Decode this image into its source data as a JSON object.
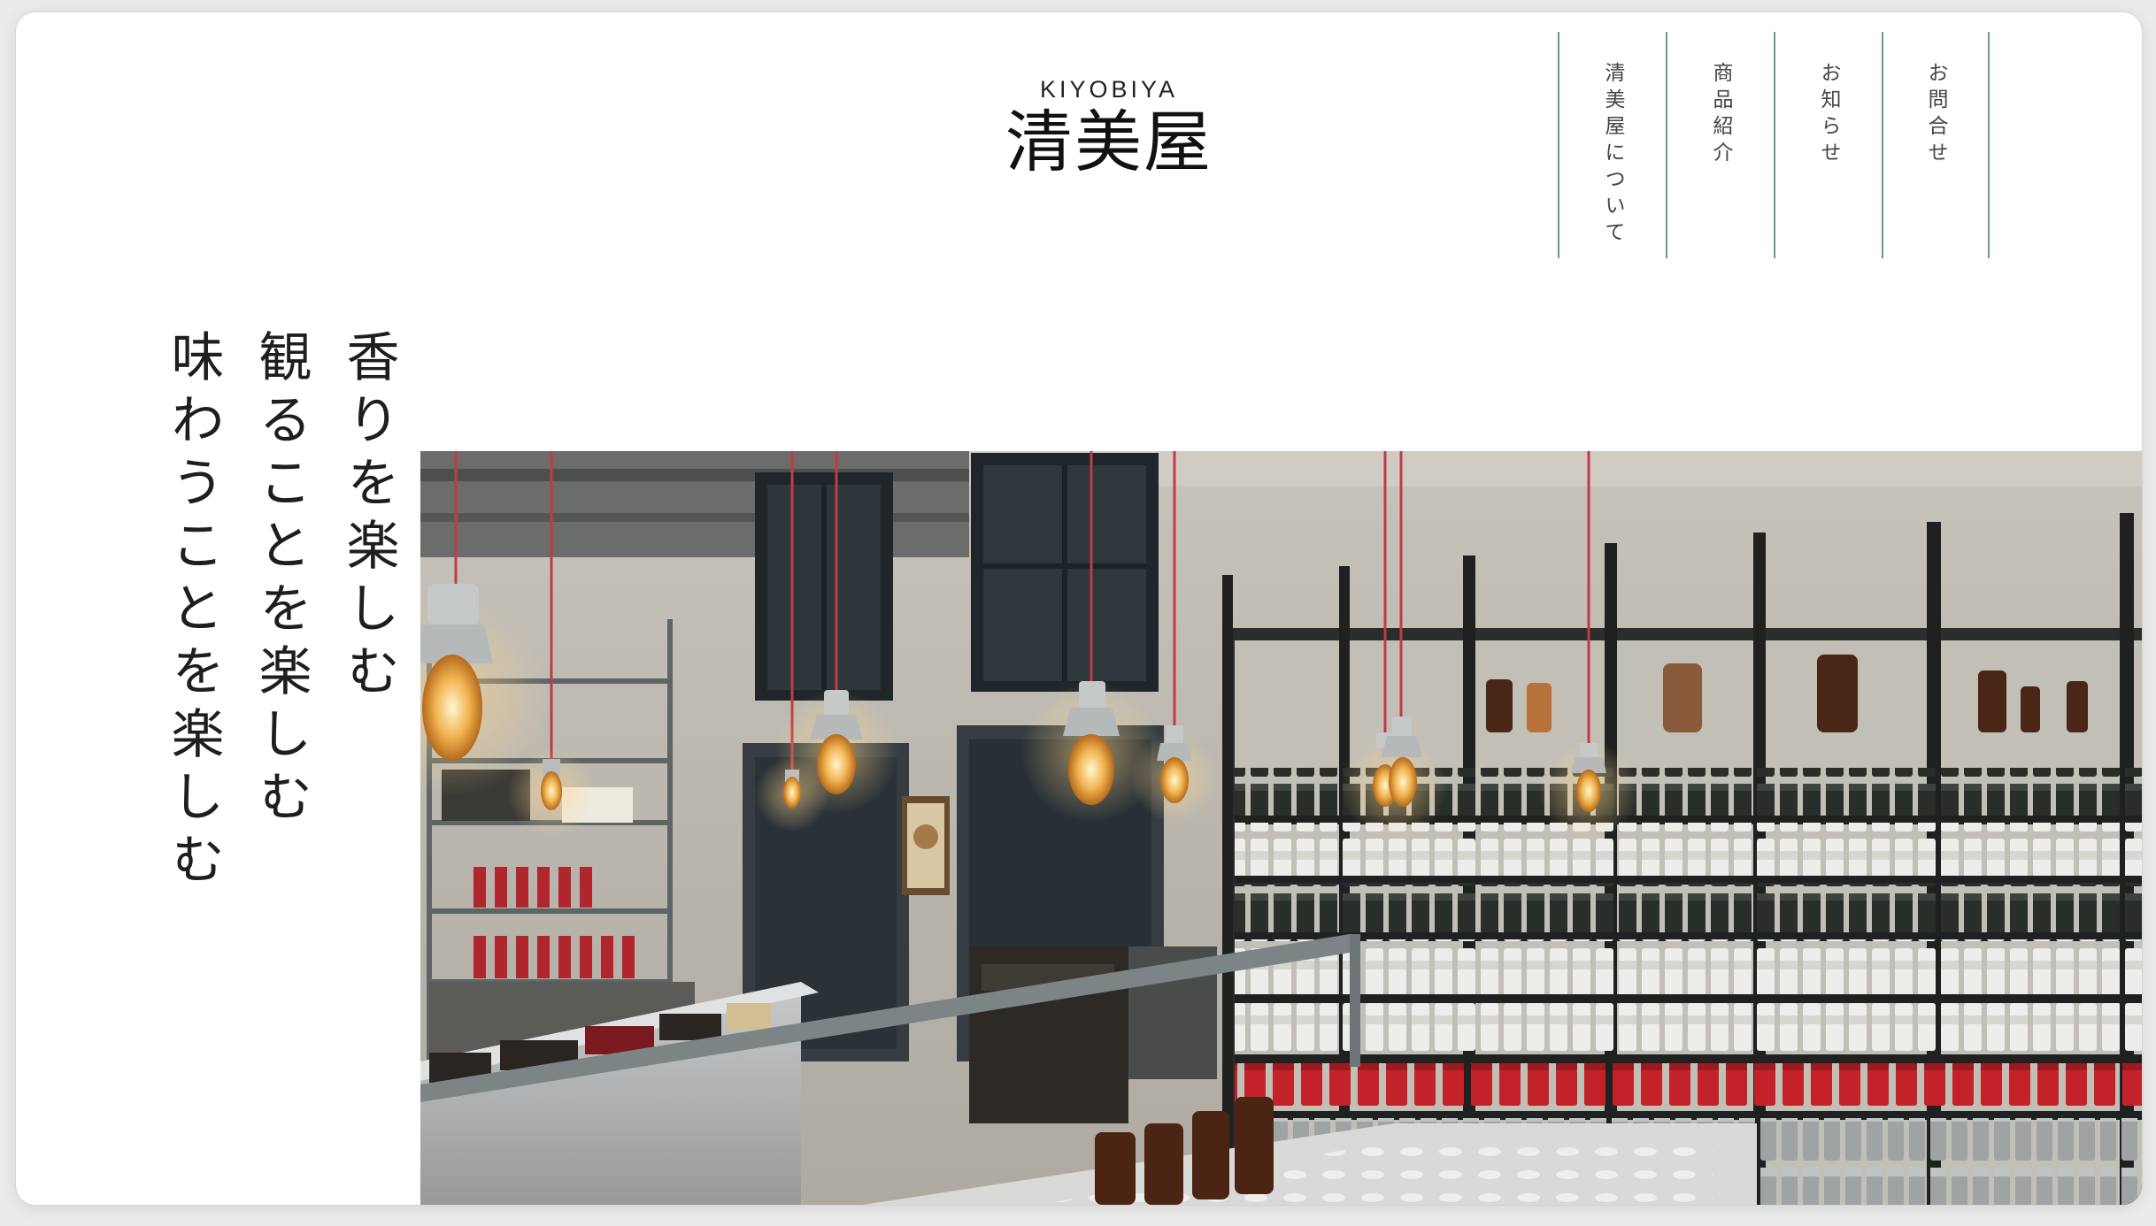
{
  "header": {
    "logo_en": "KIYOBIYA",
    "logo_ja": "清美屋"
  },
  "nav": {
    "items": [
      {
        "label": "清美屋について"
      },
      {
        "label": "商品紹介"
      },
      {
        "label": "お知らせ"
      },
      {
        "label": "お問合せ"
      }
    ]
  },
  "hero": {
    "tagline_lines": [
      "香りを楽しむ",
      "観ることを楽しむ",
      "味わうことを楽しむ"
    ]
  },
  "colors": {
    "nav_divider": "#6e9a7e",
    "background": "#ffffff",
    "text": "#1e1e1e"
  }
}
